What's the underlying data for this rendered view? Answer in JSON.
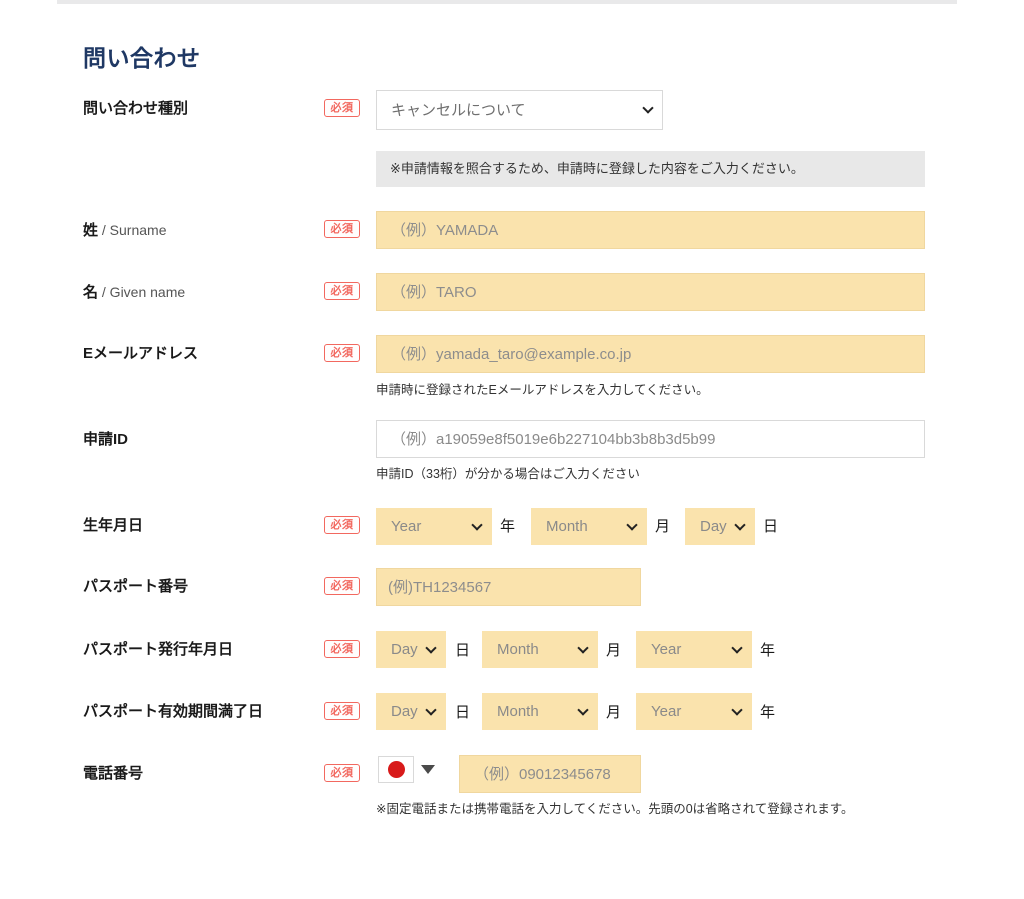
{
  "page": {
    "title": "問い合わせ"
  },
  "inquiry_type": {
    "label": "問い合わせ種別",
    "required_badge": "必須",
    "selected": "キャンセルについて",
    "options": [
      "キャンセルについて"
    ],
    "icon": "chevron-down-icon"
  },
  "notice": {
    "text": "※申請情報を照合するため、申請時に登録した内容をご入力ください。"
  },
  "surname": {
    "label_main": "姓",
    "label_sub": " / Surname",
    "required_badge": "必須",
    "placeholder": "（例）YAMADA"
  },
  "given_name": {
    "label_main": "名",
    "label_sub": " / Given name",
    "required_badge": "必須",
    "placeholder": "（例）TARO"
  },
  "email": {
    "label": "Eメールアドレス",
    "required_badge": "必須",
    "placeholder": "（例）yamada_taro@example.co.jp",
    "helper": "申請時に登録されたEメールアドレスを入力してください。"
  },
  "application_id": {
    "label": "申請ID",
    "placeholder": "（例）a19059e8f5019e6b227104bb3b8b3d5b99",
    "helper": "申請ID（33桁）が分かる場合はご入力ください"
  },
  "birth_date": {
    "label": "生年月日",
    "required_badge": "必須",
    "year_value": "Year",
    "year_unit": "年",
    "month_value": "Month",
    "month_unit": "月",
    "day_value": "Day",
    "day_unit": "日"
  },
  "passport_number": {
    "label": "パスポート番号",
    "required_badge": "必須",
    "placeholder": "(例)TH1234567"
  },
  "passport_issue_date": {
    "label": "パスポート発行年月日",
    "required_badge": "必須",
    "day_value": "Day",
    "day_unit": "日",
    "month_value": "Month",
    "month_unit": "月",
    "year_value": "Year",
    "year_unit": "年"
  },
  "passport_expiry_date": {
    "label": "パスポート有効期間満了日",
    "required_badge": "必須",
    "day_value": "Day",
    "day_unit": "日",
    "month_value": "Month",
    "month_unit": "月",
    "year_value": "Year",
    "year_unit": "年"
  },
  "phone": {
    "label": "電話番号",
    "required_badge": "必須",
    "country_flag": "flag-japan-icon",
    "caret_icon": "caret-down-icon",
    "placeholder": "（例）09012345678",
    "helper": "※固定電話または携帯電話を入力してください。先頭の0は省略されて登録されます。"
  },
  "colors": {
    "title": "#1f3864",
    "required_red": "#f2685f",
    "field_yellow": "#fae3ad",
    "notice_grey": "#e8e8e8",
    "border_grey": "#d9d9d9"
  }
}
